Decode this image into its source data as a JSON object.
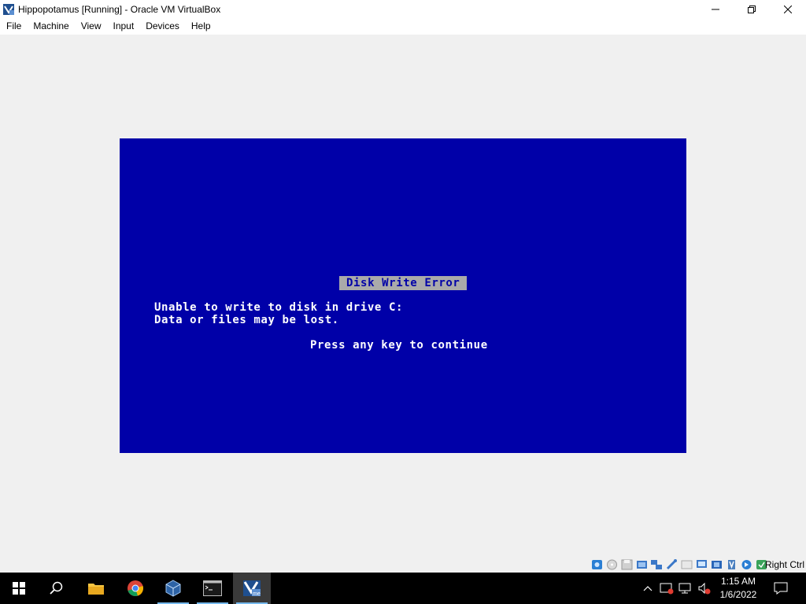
{
  "window": {
    "title": "Hippopotamus [Running] - Oracle VM VirtualBox"
  },
  "menu": {
    "items": [
      "File",
      "Machine",
      "View",
      "Input",
      "Devices",
      "Help"
    ]
  },
  "vm_screen": {
    "error_title": "Disk Write Error",
    "line1": "Unable to write to disk in drive C:",
    "line2": "Data or files may be lost.",
    "prompt": "Press any key to continue",
    "colors": {
      "background": "#0000a8",
      "text": "#ffffff",
      "title_bg": "#aaaaaa"
    }
  },
  "status_bar": {
    "icons": [
      "hard-disk-icon",
      "optical-drive-icon",
      "floppy-icon",
      "audio-icon",
      "network-icon",
      "usb-icon",
      "shared-folders-icon",
      "display-icon",
      "recording-icon",
      "cpu-icon",
      "mouse-integration-icon",
      "host-key-icon"
    ],
    "host_key": "Right Ctrl"
  },
  "taskbar": {
    "buttons": [
      "start-button",
      "search-button",
      "file-explorer",
      "chrome",
      "virtualbox-manager",
      "command-prompt",
      "virtualbox-vm"
    ],
    "tray": [
      "chevron-up-icon",
      "action-center-alert-icon",
      "network-icon",
      "volume-muted-icon",
      "notifications-icon"
    ],
    "time": "1:15 AM",
    "date": "1/6/2022"
  }
}
